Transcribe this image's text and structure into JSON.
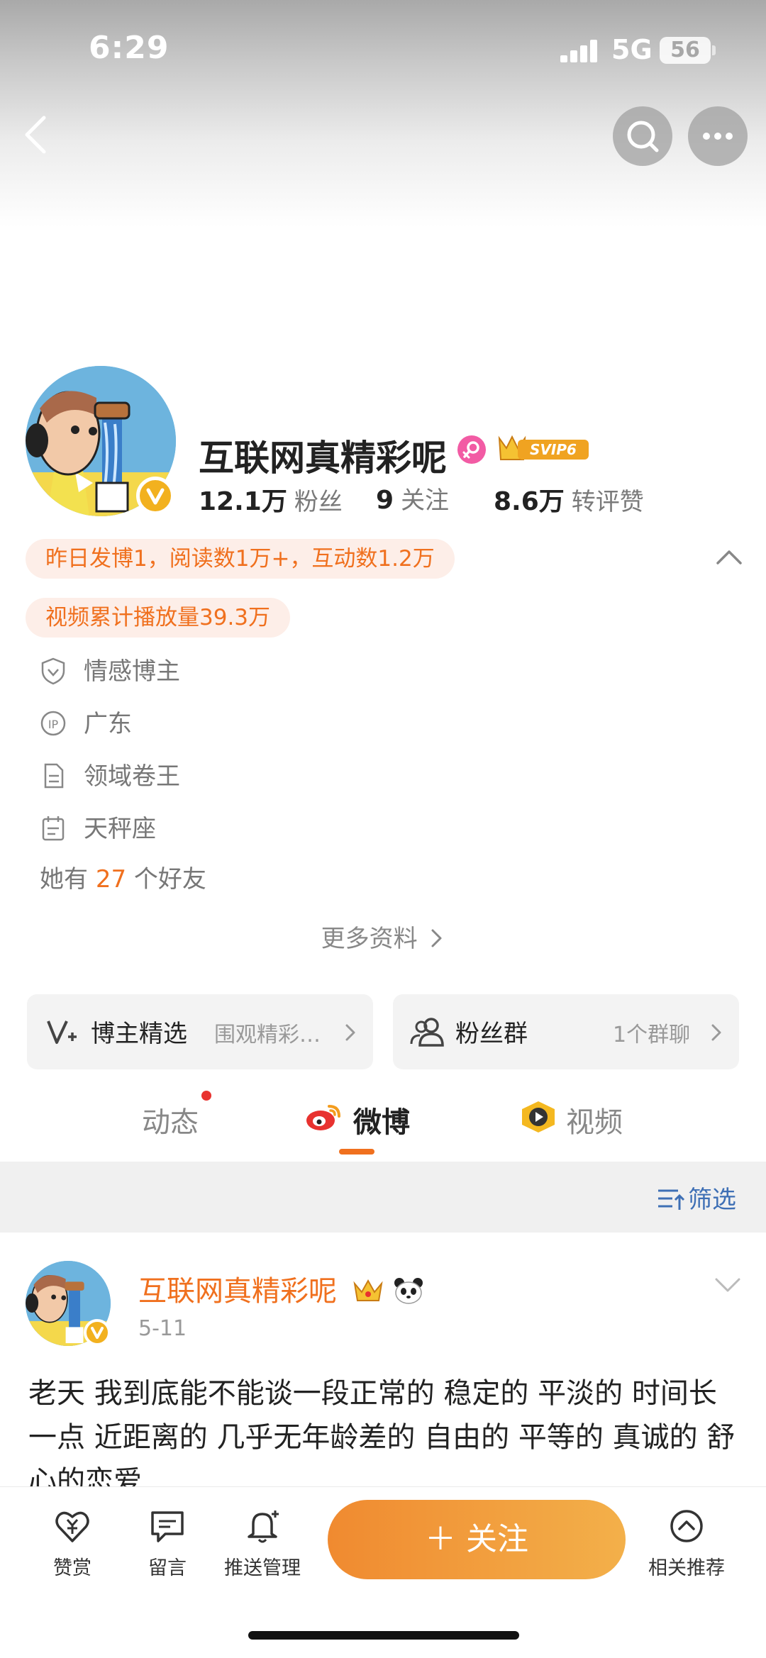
{
  "status_bar": {
    "time": "6:29",
    "network": "5G",
    "battery": "56"
  },
  "profile": {
    "name": "互联网真精彩呢",
    "vip_badge": "SVIP6",
    "stats": [
      {
        "value": "12.1万",
        "label": "粉丝"
      },
      {
        "value": "9",
        "label": "关注"
      },
      {
        "value": "8.6万",
        "label": "转评赞"
      }
    ],
    "highlights": [
      "昨日发博1，阅读数1万+，互动数1.2万",
      "视频累计播放量39.3万"
    ],
    "info": [
      {
        "icon": "shield-icon",
        "text": "情感博主"
      },
      {
        "icon": "ip-icon",
        "text": "广东"
      },
      {
        "icon": "document-icon",
        "text": "领域卷王"
      },
      {
        "icon": "calendar-icon",
        "text": "天秤座"
      }
    ],
    "friends_prefix": "她有",
    "friends_count": "27",
    "friends_suffix": "个好友",
    "more_info": "更多资料"
  },
  "cards": [
    {
      "title": "博主精选",
      "subtitle": "围观精彩…"
    },
    {
      "title": "粉丝群",
      "subtitle": "1个群聊"
    }
  ],
  "tabs": [
    "动态",
    "微博",
    "视频"
  ],
  "active_tab": "微博",
  "filter_label": "筛选",
  "post": {
    "user": "互联网真精彩呢",
    "date": "5-11",
    "text": "老天 我到底能不能谈一段正常的 稳定的 平淡的 时间长一点 近距离的 几乎无年龄差的 自由的 平等的 真诚的 舒心的恋爱"
  },
  "bottom_bar": {
    "items": [
      "赞赏",
      "留言",
      "推送管理"
    ],
    "follow": "＋ 关注",
    "recommend": "相关推荐"
  },
  "colors": {
    "accent": "#f0701e",
    "link_blue": "#3e6fb5",
    "pill_bg": "#fdeee8"
  }
}
